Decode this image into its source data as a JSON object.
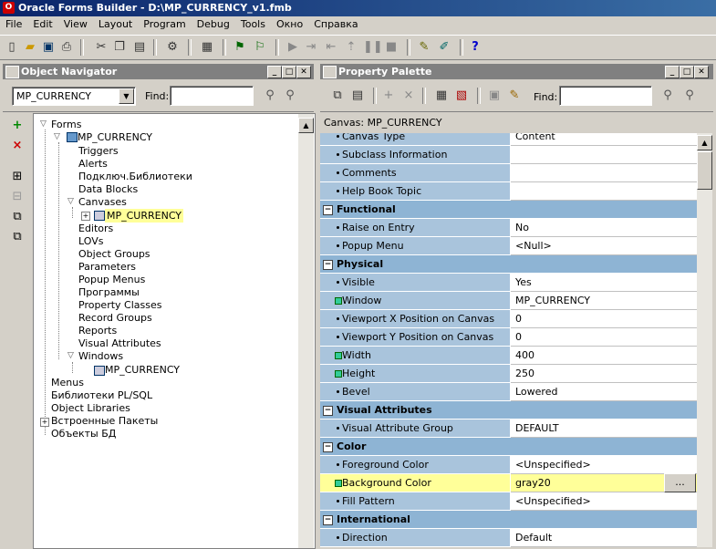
{
  "window": {
    "title": "Oracle Forms Builder - D:\\MP_CURRENCY_v1.fmb"
  },
  "menu": [
    "File",
    "Edit",
    "View",
    "Layout",
    "Program",
    "Debug",
    "Tools",
    "Окно",
    "Справка"
  ],
  "toolbar_icons": [
    "new-icon",
    "open-icon",
    "save-icon",
    "print-icon",
    "cut-icon",
    "copy-icon",
    "paste-icon",
    "run-form-icon",
    "compile-icon",
    "debug-icon",
    "step-icon",
    "step-into-icon",
    "step-over-icon",
    "step-out-icon",
    "pause-icon",
    "stop-icon",
    "wizard-icon",
    "layout-wizard-icon",
    "help-icon"
  ],
  "navigator": {
    "title": "Object Navigator",
    "module_select": "MP_CURRENCY",
    "find_label": "Find:",
    "find_value": "",
    "tree": [
      {
        "label": "Forms"
      },
      {
        "label": "MP_CURRENCY"
      },
      {
        "label": "Triggers"
      },
      {
        "label": "Alerts"
      },
      {
        "label": "Подключ.Библиотеки"
      },
      {
        "label": "Data Blocks"
      },
      {
        "label": "Canvases"
      },
      {
        "label": "MP_CURRENCY"
      },
      {
        "label": "Editors"
      },
      {
        "label": "LOVs"
      },
      {
        "label": "Object Groups"
      },
      {
        "label": "Parameters"
      },
      {
        "label": "Popup Menus"
      },
      {
        "label": "Программы"
      },
      {
        "label": "Property Classes"
      },
      {
        "label": "Record Groups"
      },
      {
        "label": "Reports"
      },
      {
        "label": "Visual Attributes"
      },
      {
        "label": "Windows"
      },
      {
        "label": "MP_CURRENCY"
      },
      {
        "label": "Menus"
      },
      {
        "label": "Библиотеки PL/SQL"
      },
      {
        "label": "Object Libraries"
      },
      {
        "label": "Встроенные Пакеты"
      },
      {
        "label": "Объекты БД"
      }
    ]
  },
  "palette": {
    "title": "Property Palette",
    "find_label": "Find:",
    "find_value": "",
    "context": "Canvas: MP_CURRENCY",
    "more_button": "...",
    "rows": [
      {
        "type": "prop",
        "name": "Canvas Type",
        "value": "Content",
        "mark": "dot"
      },
      {
        "type": "prop",
        "name": "Subclass Information",
        "value": "",
        "mark": "dot"
      },
      {
        "type": "prop",
        "name": "Comments",
        "value": "",
        "mark": "dot"
      },
      {
        "type": "prop",
        "name": "Help Book Topic",
        "value": "",
        "mark": "dot"
      },
      {
        "type": "section",
        "name": "Functional"
      },
      {
        "type": "prop",
        "name": "Raise on Entry",
        "value": "No",
        "mark": "dot"
      },
      {
        "type": "prop",
        "name": "Popup Menu",
        "value": "<Null>",
        "mark": "dot"
      },
      {
        "type": "section",
        "name": "Physical"
      },
      {
        "type": "prop",
        "name": "Visible",
        "value": "Yes",
        "mark": "dot"
      },
      {
        "type": "prop",
        "name": "Window",
        "value": "MP_CURRENCY",
        "mark": "square"
      },
      {
        "type": "prop",
        "name": "Viewport X Position on Canvas",
        "value": "0",
        "mark": "dot"
      },
      {
        "type": "prop",
        "name": "Viewport Y Position on Canvas",
        "value": "0",
        "mark": "dot"
      },
      {
        "type": "prop",
        "name": "Width",
        "value": "400",
        "mark": "square"
      },
      {
        "type": "prop",
        "name": "Height",
        "value": "250",
        "mark": "square"
      },
      {
        "type": "prop",
        "name": "Bevel",
        "value": "Lowered",
        "mark": "dot"
      },
      {
        "type": "section",
        "name": "Visual Attributes"
      },
      {
        "type": "prop",
        "name": "Visual Attribute Group",
        "value": "DEFAULT",
        "mark": "dot"
      },
      {
        "type": "section",
        "name": "Color"
      },
      {
        "type": "prop",
        "name": "Foreground Color",
        "value": "<Unspecified>",
        "mark": "dot"
      },
      {
        "type": "prop",
        "name": "Background Color",
        "value": "gray20",
        "mark": "square",
        "highlight": true
      },
      {
        "type": "prop",
        "name": "Fill Pattern",
        "value": "<Unspecified>",
        "mark": "dot"
      },
      {
        "type": "section",
        "name": "International"
      },
      {
        "type": "prop",
        "name": "Direction",
        "value": "Default",
        "mark": "dot"
      }
    ]
  },
  "colors": {
    "title_active": "#0a246a",
    "panel_title": "#808080",
    "prop_name_bg": "#a9c4dc",
    "section_bg": "#8eb4d4",
    "highlight": "#ffff99"
  }
}
